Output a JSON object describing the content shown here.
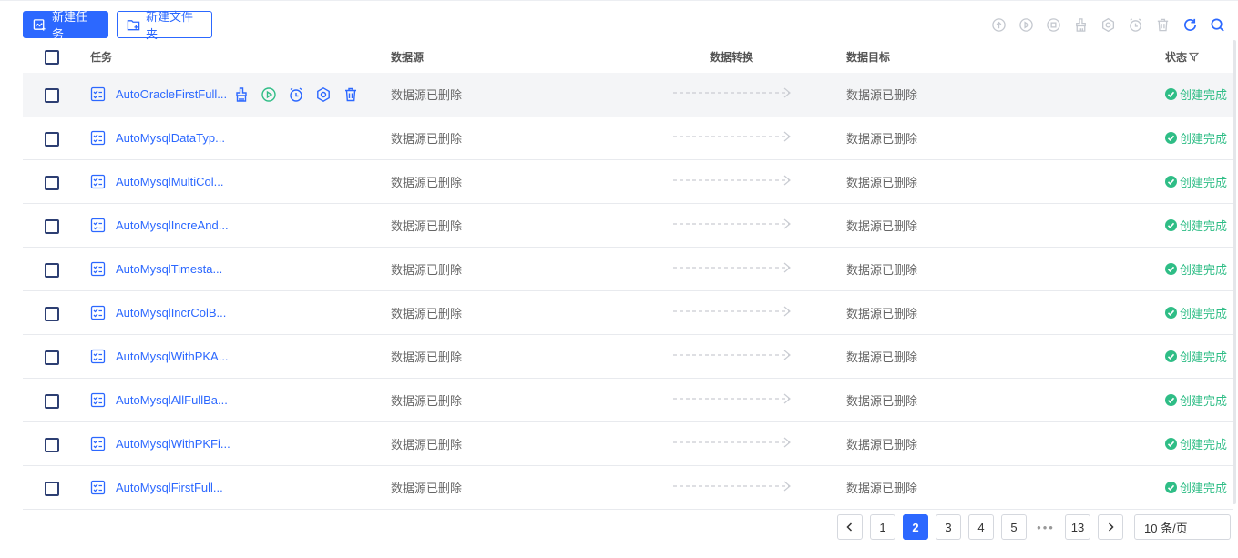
{
  "toolbar": {
    "new_task": "新建任务",
    "new_folder": "新建文件夹"
  },
  "top_actions": [
    "upload-icon",
    "play-icon",
    "stop-icon",
    "clean-icon",
    "settings-icon",
    "schedule-icon",
    "delete-icon",
    "refresh-icon",
    "search-icon"
  ],
  "table": {
    "headers": {
      "task": "任务",
      "source": "数据源",
      "transform": "数据转换",
      "target": "数据目标",
      "status": "状态"
    },
    "rows": [
      {
        "name": "AutoOracleFirstFull...",
        "source": "数据源已删除",
        "target": "数据源已删除",
        "status": "创建完成",
        "hovered": true
      },
      {
        "name": "AutoMysqlDataTyp...",
        "source": "数据源已删除",
        "target": "数据源已删除",
        "status": "创建完成"
      },
      {
        "name": "AutoMysqlMultiCol...",
        "source": "数据源已删除",
        "target": "数据源已删除",
        "status": "创建完成"
      },
      {
        "name": "AutoMysqlIncreAnd...",
        "source": "数据源已删除",
        "target": "数据源已删除",
        "status": "创建完成"
      },
      {
        "name": "AutoMysqlTimesta...",
        "source": "数据源已删除",
        "target": "数据源已删除",
        "status": "创建完成"
      },
      {
        "name": "AutoMysqlIncrColB...",
        "source": "数据源已删除",
        "target": "数据源已删除",
        "status": "创建完成"
      },
      {
        "name": "AutoMysqlWithPKA...",
        "source": "数据源已删除",
        "target": "数据源已删除",
        "status": "创建完成"
      },
      {
        "name": "AutoMysqlAllFullBa...",
        "source": "数据源已删除",
        "target": "数据源已删除",
        "status": "创建完成"
      },
      {
        "name": "AutoMysqlWithPKFi...",
        "source": "数据源已删除",
        "target": "数据源已删除",
        "status": "创建完成"
      },
      {
        "name": "AutoMysqlFirstFull...",
        "source": "数据源已删除",
        "target": "数据源已删除",
        "status": "创建完成"
      }
    ]
  },
  "pagination": {
    "pages": [
      "1",
      "2",
      "3",
      "4",
      "5"
    ],
    "current": "2",
    "ellipsis": "•••",
    "last": "13",
    "page_size": "10 条/页"
  },
  "colors": {
    "primary": "#2c68ff",
    "success": "#2fbd86",
    "disabled_icon": "#c4c8cf"
  }
}
